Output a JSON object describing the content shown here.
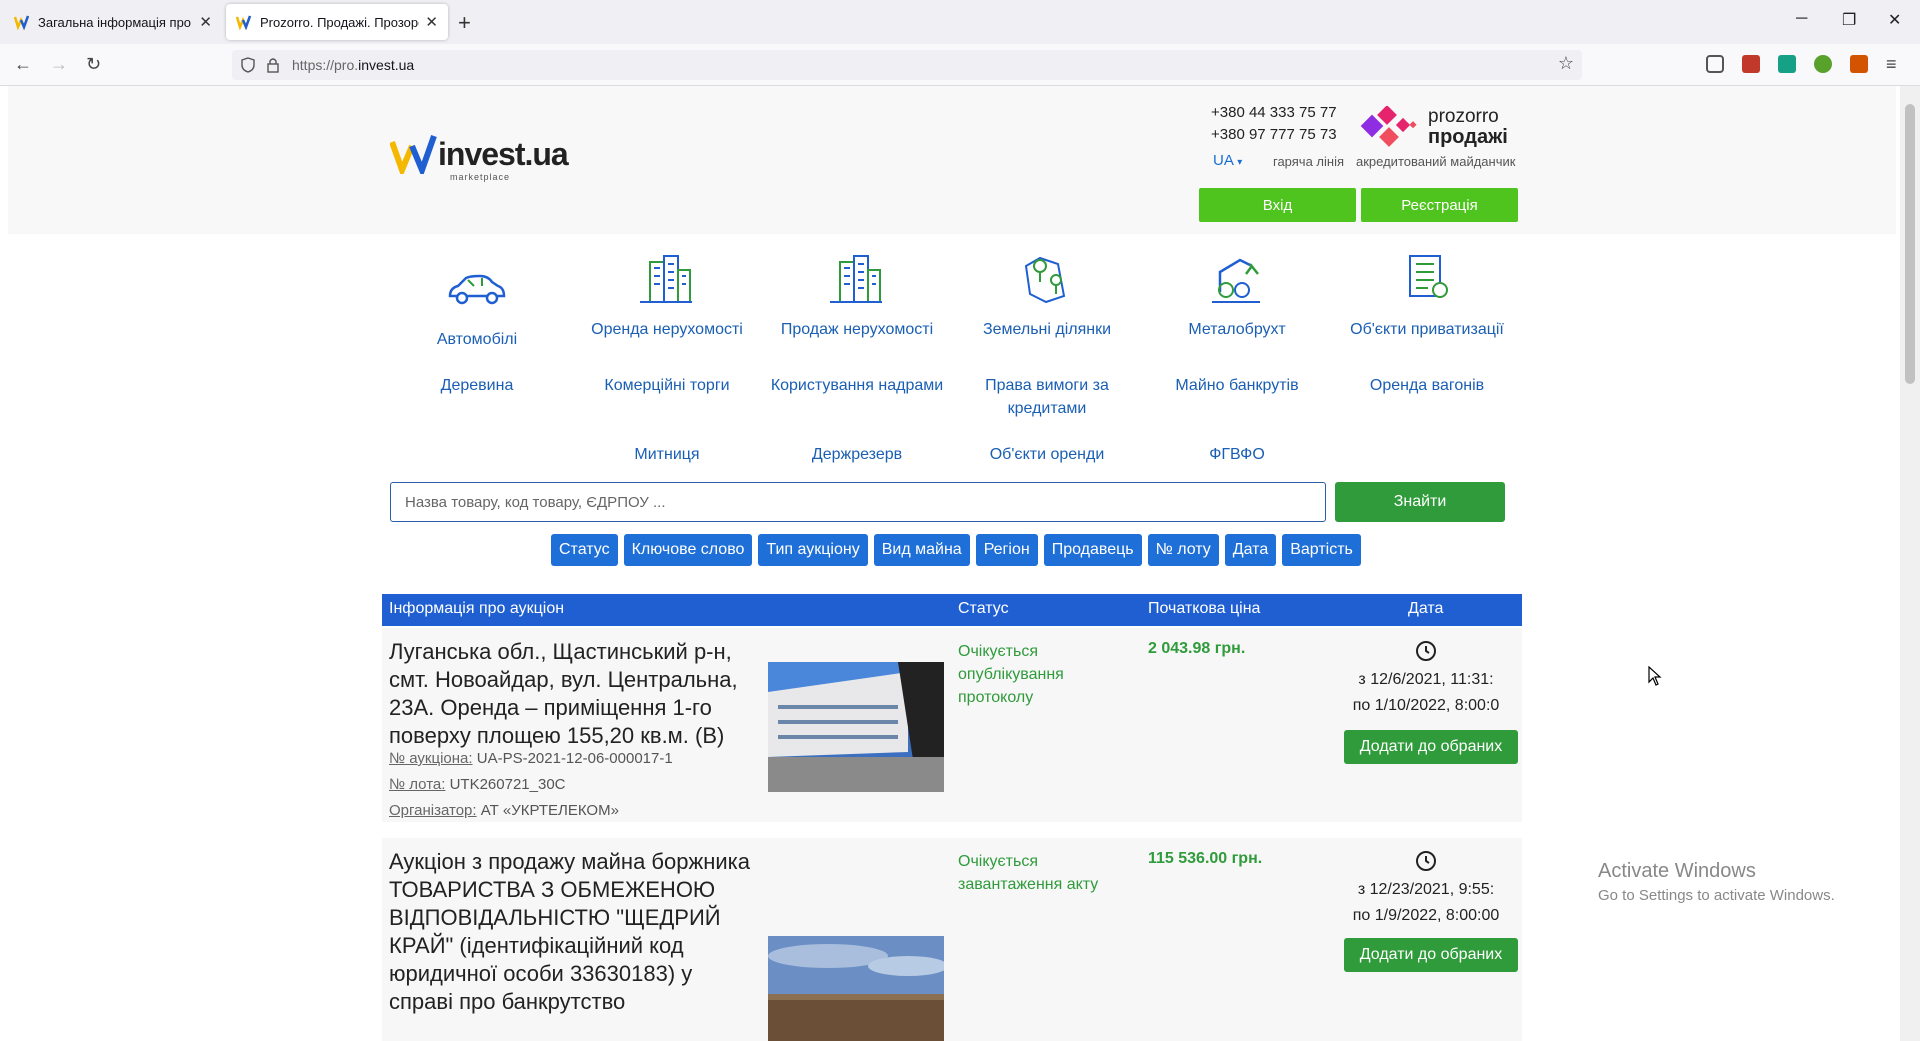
{
  "browser": {
    "tabs": [
      {
        "title": "Загальна інформація про про"
      },
      {
        "title": "Prozorro. Продажі. Прозоро"
      }
    ],
    "new_tab": "+",
    "url_prefix": "https://pro.",
    "url_domain": "invest.ua"
  },
  "header": {
    "logo_text": "invest.ua",
    "logo_sub": "marketplace",
    "phone1": "+380 44 333 75 77",
    "phone2": "+380 97 777 75 73",
    "lang": "UA",
    "hotline": "гаряча лінія",
    "prozorro_top": "prozorro",
    "prozorro_bottom": "продажі",
    "accredited": "акредитований майданчик",
    "login": "Вхід",
    "register": "Реєстрація",
    "colors": {
      "green": "#4fc41e",
      "blue": "#1f5fd1",
      "dark_green": "#2f9b3b"
    }
  },
  "categories": {
    "row1": [
      {
        "label": "Автомобілі",
        "icon": "car-icon"
      },
      {
        "label": "Оренда нерухомості",
        "icon": "buildings-icon"
      },
      {
        "label": "Продаж нерухомості",
        "icon": "buildings-icon"
      },
      {
        "label": "Земельні ділянки",
        "icon": "land-map-icon"
      },
      {
        "label": "Металобрухт",
        "icon": "scrap-metal-icon"
      },
      {
        "label": "Об'єкти приватизації",
        "icon": "document-icon"
      }
    ],
    "row2": [
      "Деревина",
      "Комерційні торги",
      "Користування надрами",
      "Права вимоги за кредитами",
      "Майно банкрутів",
      "Оренда вагонів"
    ],
    "row3": [
      "Митниця",
      "Держрезерв",
      "Об'єкти оренди",
      "ФГВФО"
    ]
  },
  "search": {
    "placeholder": "Назва товару, код товару, ЄДРПОУ ...",
    "button": "Знайти"
  },
  "filters": [
    "Статус",
    "Ключове слово",
    "Тип аукціону",
    "Вид майна",
    "Регіон",
    "Продавець",
    "№ лоту",
    "Дата",
    "Вартість"
  ],
  "table": {
    "headers": [
      "Інформація про аукціон",
      "Статус",
      "Початкова ціна",
      "Дата"
    ],
    "rows": [
      {
        "title": "Луганська обл., Щастинський р-н, смт. Новоайдар, вул. Центральна, 23А. Оренда – приміщення 1-го поверху площею 155,20 кв.м. (В)",
        "auction_label": "№ аукціона:",
        "auction_value": "UA-PS-2021-12-06-000017-1",
        "lot_label": "№ лота:",
        "lot_value": "UTK260721_30C",
        "org_label": "Організатор:",
        "org_value": "АТ «УКРТЕЛЕКОМ»",
        "status": "Очікується опублікування протоколу",
        "price": "2 043.98 грн.",
        "date_from": "з 12/6/2021, 11:31:",
        "date_to": "по 1/10/2022, 8:00:0",
        "fav": "Додати до обраних"
      },
      {
        "title": "Аукціон з продажу майна боржника ТОВАРИСТВА З ОБМЕЖЕНОЮ ВІДПОВІДАЛЬНІСТЮ \"ЩЕДРИЙ КРАЙ\" (ідентифікаційний код юридичної особи 33630183) у справі про банкрутство",
        "status": "Очікується завантаження акту",
        "price": "115 536.00 грн.",
        "date_from": "з 12/23/2021, 9:55:",
        "date_to": "по 1/9/2022, 8:00:00",
        "fav": "Додати до обраних"
      }
    ]
  },
  "watermark": {
    "line1": "Activate Windows",
    "line2": "Go to Settings to activate Windows."
  }
}
